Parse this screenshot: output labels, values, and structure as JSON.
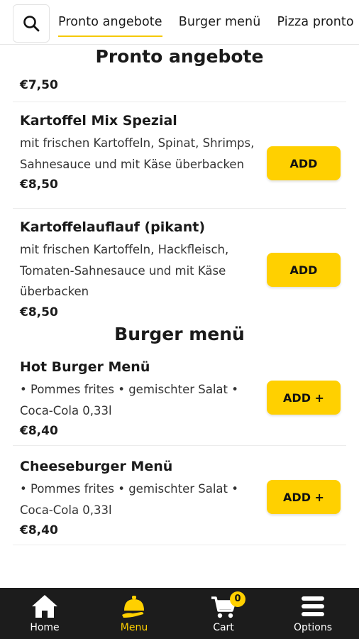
{
  "tabs": [
    "Pronto angebote",
    "Burger menü",
    "Pizza pronto"
  ],
  "sections": {
    "pronto": {
      "title": "Pronto angebote",
      "partial_price": "€7,50",
      "items": [
        {
          "name": "Kartoffel Mix Spezial",
          "desc": "mit frischen Kartoffeln, Spinat, Shrimps, Sahnesauce und mit Käse überbacken",
          "price": "€8,50",
          "button": "ADD"
        },
        {
          "name": "Kartoffelauflauf (pikant)",
          "desc": "mit frischen Kartoffeln, Hackfleisch, Tomaten-Sahnesauce und mit Käse überbacken",
          "price": "€8,50",
          "button": "ADD"
        }
      ]
    },
    "burger": {
      "title": "Burger menü",
      "items": [
        {
          "name": "Hot Burger Menü",
          "desc": "• Pommes frites • gemischter Salat • Coca-Cola 0,33l",
          "price": "€8,40",
          "button": "ADD +"
        },
        {
          "name": "Cheeseburger Menü",
          "desc": "• Pommes frites • gemischter Salat • Coca-Cola 0,33l",
          "price": "€8,40",
          "button": "ADD +"
        }
      ]
    }
  },
  "nav": {
    "home": "Home",
    "menu": "Menu",
    "cart": "Cart",
    "cart_count": "0",
    "options": "Options"
  },
  "colors": {
    "accent": "#ffd000",
    "nav_bg": "#1c1c1c"
  }
}
